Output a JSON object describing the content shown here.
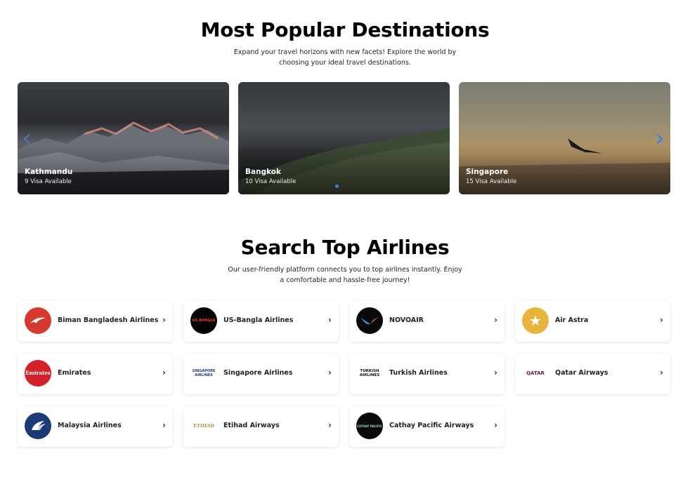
{
  "destinations_section": {
    "title": "Most Popular Destinations",
    "subtitle_line1": "Expand your travel horizons with new facets! Explore the world by",
    "subtitle_line2": "choosing your ideal travel destinations.",
    "cards": [
      {
        "name": "Kathmandu",
        "visa": "9 Visa Available"
      },
      {
        "name": "Bangkok",
        "visa": "10 Visa Available"
      },
      {
        "name": "Singapore",
        "visa": "15 Visa Available"
      }
    ],
    "prev_arrow": "‹",
    "next_arrow": "›"
  },
  "airlines_section": {
    "title": "Search Top Airlines",
    "subtitle_line1": "Our user-friendly platform connects you to top airlines instantly. Enjoy",
    "subtitle_line2": "a comfortable and hassle-free journey!",
    "chevron": "›",
    "airlines": [
      {
        "name": "Biman Bangladesh Airlines",
        "logo_text": ""
      },
      {
        "name": "US-Bangla Airlines",
        "logo_text": "US-BANGLA"
      },
      {
        "name": "NOVOAIR",
        "logo_text": ""
      },
      {
        "name": "Air Astra",
        "logo_text": "★"
      },
      {
        "name": "Emirates",
        "logo_text": "Emirates"
      },
      {
        "name": "Singapore Airlines",
        "logo_text": "SINGAPORE AIRLINES"
      },
      {
        "name": "Turkish Airlines",
        "logo_text": "TURKISH AIRLINES"
      },
      {
        "name": "Qatar Airways",
        "logo_text": "QATAR"
      },
      {
        "name": "Malaysia Airlines",
        "logo_text": ""
      },
      {
        "name": "Etihad Airways",
        "logo_text": "ETIHAD"
      },
      {
        "name": "Cathay Pacific Airways",
        "logo_text": "CATHAY PACIFIC"
      }
    ]
  }
}
